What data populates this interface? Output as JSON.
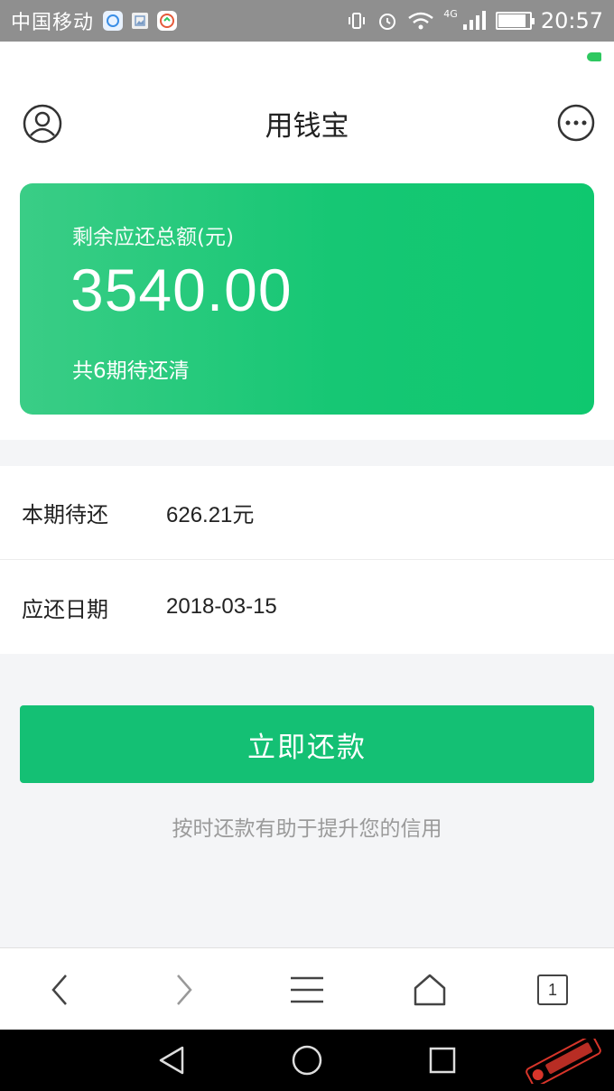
{
  "status_bar": {
    "carrier": "中国移动",
    "network": "4G",
    "time": "20:57",
    "battery_level": 0.9
  },
  "header": {
    "title": "用钱宝"
  },
  "card": {
    "label": "剩余应还总额(元)",
    "amount": "3540.00",
    "periods_text": "共6期待还清"
  },
  "details": {
    "rows": [
      {
        "label": "本期待还",
        "value": "626.21元"
      },
      {
        "label": "应还日期",
        "value": "2018-03-15"
      }
    ]
  },
  "repay_button_label": "立即还款",
  "tip": "按时还款有助于提升您的信用",
  "browser_toolbar": {
    "tab_count": "1"
  },
  "icons": {
    "avatar": "user-circle-icon",
    "more": "more-dots-icon",
    "back": "chevron-left-icon",
    "forward": "chevron-right-icon",
    "menu": "menu-icon",
    "home": "home-icon",
    "tabs": "tabs-icon"
  },
  "colors": {
    "accent": "#14c074",
    "card_gradient_start": "#3acd86",
    "card_gradient_end": "#0fc86f",
    "tip_text": "#9a9a9a"
  }
}
